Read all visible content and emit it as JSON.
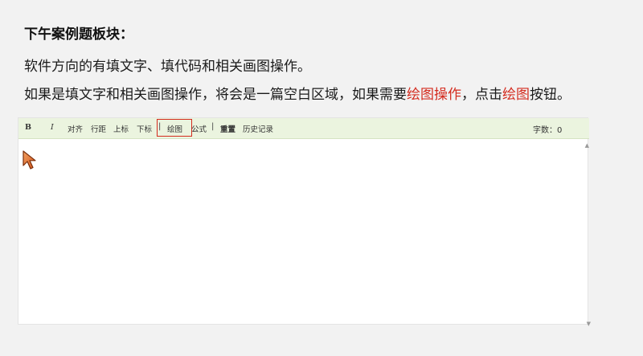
{
  "title": "下午案例题板块：",
  "line1": "软件方向的有填文字、填代码和相关画图操作。",
  "line2": {
    "part1": "如果是填文字和相关画图操作，将会是一篇空白区域，如果需要",
    "highlight1": "绘图操作",
    "part2": "，点击",
    "highlight2": "绘图",
    "part3": "按钮。"
  },
  "colors": {
    "highlight": "#d42b1e",
    "toolbar_bg": "#ebf4df"
  },
  "toolbar": {
    "bold": "B",
    "italic": "I",
    "align": "对齐",
    "line_spacing": "行距",
    "superscript": "上标",
    "subscript": "下标",
    "separator": "|",
    "draw": "绘图",
    "formula": "公式",
    "reset": "重置",
    "history": "历史记录",
    "word_count_label": "字数：",
    "word_count_value": "0"
  },
  "editor": {
    "content": ""
  },
  "icons": {
    "cursor": "mouse-pointer-icon",
    "scroll_up": "scroll-up-arrow-icon",
    "scroll_down": "scroll-down-arrow-icon"
  }
}
